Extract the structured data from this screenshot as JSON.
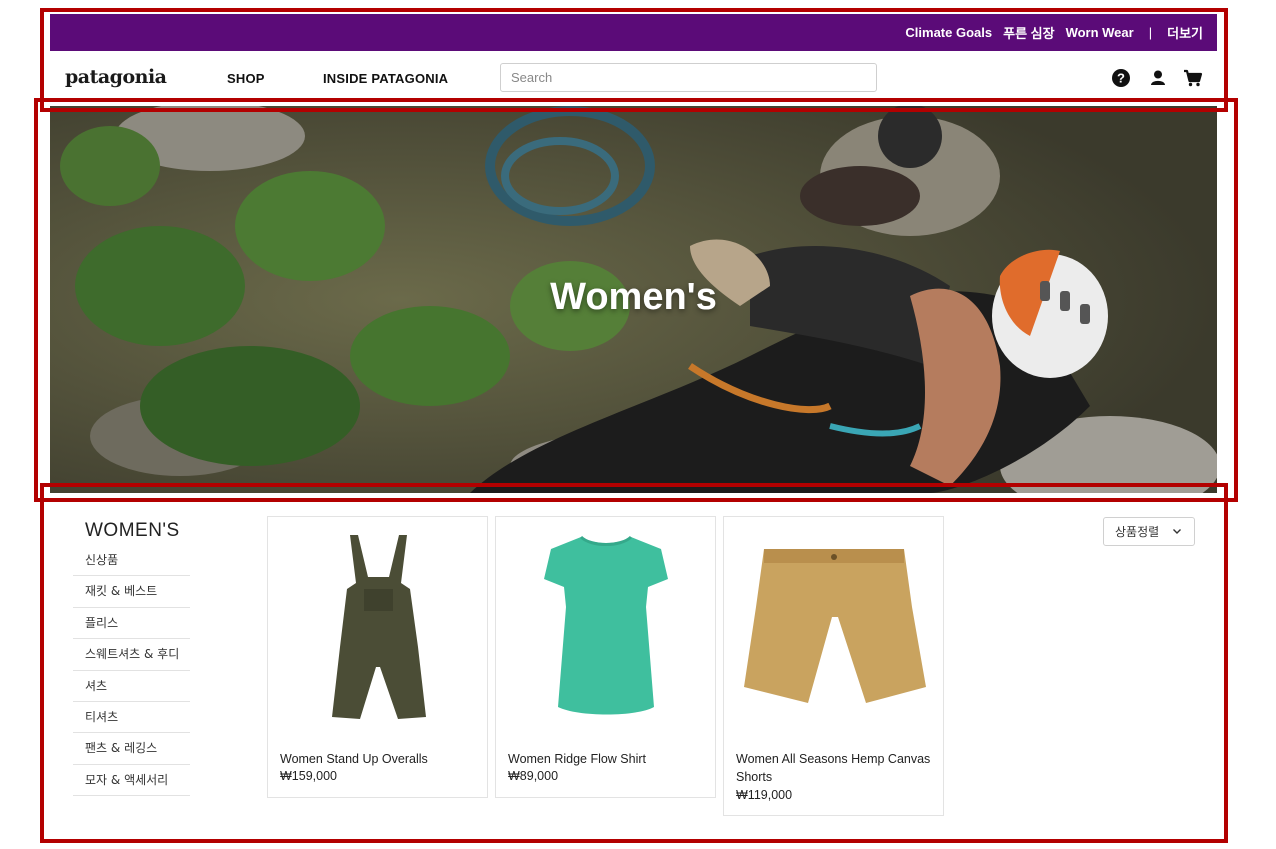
{
  "utility_bar": {
    "links": [
      "Climate Goals",
      "푸른 심장",
      "Worn Wear"
    ],
    "separator": "|",
    "more": "더보기",
    "bg_color": "#5b0b78"
  },
  "nav": {
    "logo": "patagonia",
    "links": [
      "SHOP",
      "INSIDE PATAGONIA"
    ],
    "search_placeholder": "Search",
    "icons": [
      "help-icon",
      "user-icon",
      "cart-icon"
    ]
  },
  "hero": {
    "title": "Women's"
  },
  "sidebar": {
    "title": "WOMEN'S",
    "items": [
      "신상품",
      "재킷 & 베스트",
      "플리스",
      "스웨트셔츠 & 후디",
      "셔츠",
      "티셔츠",
      "팬츠 & 레깅스",
      "모자 & 액세서리"
    ]
  },
  "sort": {
    "selected": "상품정렬"
  },
  "products": [
    {
      "name": "Women Stand Up Overalls",
      "price": "₩159,000",
      "color": "#4b4d36"
    },
    {
      "name": "Women Ridge Flow Shirt",
      "price": "₩89,000",
      "color": "#3fbf9e"
    },
    {
      "name": "Women All Seasons Hemp Canvas Shorts",
      "price": "₩119,000",
      "color": "#c9a35f"
    }
  ]
}
